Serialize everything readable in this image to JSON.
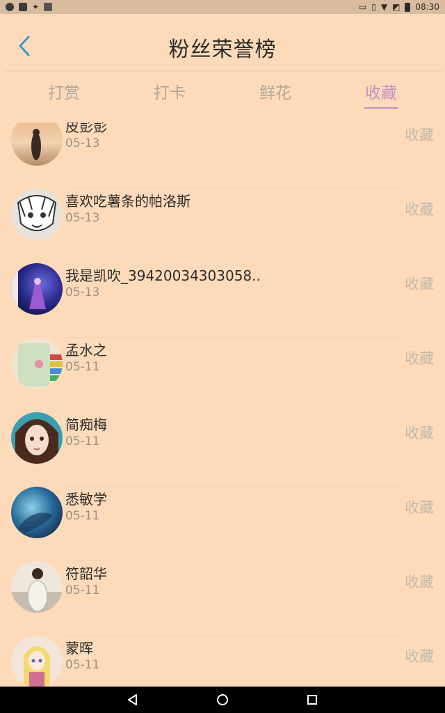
{
  "status_bar": {
    "time": "08:30",
    "left_icons": [
      "app-icon",
      "image-icon",
      "cleaner-icon",
      "gallery-icon"
    ],
    "right_icons": [
      "cast-icon",
      "vibrate-icon",
      "wifi-icon",
      "no-sim-icon",
      "battery-icon"
    ]
  },
  "header": {
    "title": "粉丝荣誉榜",
    "back_icon": "chevron-left-icon"
  },
  "tabs": [
    {
      "label": "打赏",
      "active": false
    },
    {
      "label": "打卡",
      "active": false
    },
    {
      "label": "鲜花",
      "active": false
    },
    {
      "label": "收藏",
      "active": true
    }
  ],
  "list": [
    {
      "name": "皮彭彭",
      "date": "05-13",
      "action": "收藏"
    },
    {
      "name": "喜欢吃薯条的帕洛斯",
      "date": "05-13",
      "action": "收藏"
    },
    {
      "name": "我是凯吹_39420034303058..",
      "date": "05-13",
      "action": "收藏"
    },
    {
      "name": "孟水之",
      "date": "05-11",
      "action": "收藏"
    },
    {
      "name": "简痴梅",
      "date": "05-11",
      "action": "收藏"
    },
    {
      "name": "悉敏学",
      "date": "05-11",
      "action": "收藏"
    },
    {
      "name": "符韶华",
      "date": "05-11",
      "action": "收藏"
    },
    {
      "name": "蒙晖",
      "date": "05-11",
      "action": "收藏"
    }
  ],
  "colors": {
    "background": "#fddbba",
    "active_tab": "#c490c6",
    "back_arrow": "#3a9bbf"
  },
  "nav_bar": {
    "buttons": [
      "back-triangle-icon",
      "home-circle-icon",
      "recents-square-icon"
    ]
  }
}
